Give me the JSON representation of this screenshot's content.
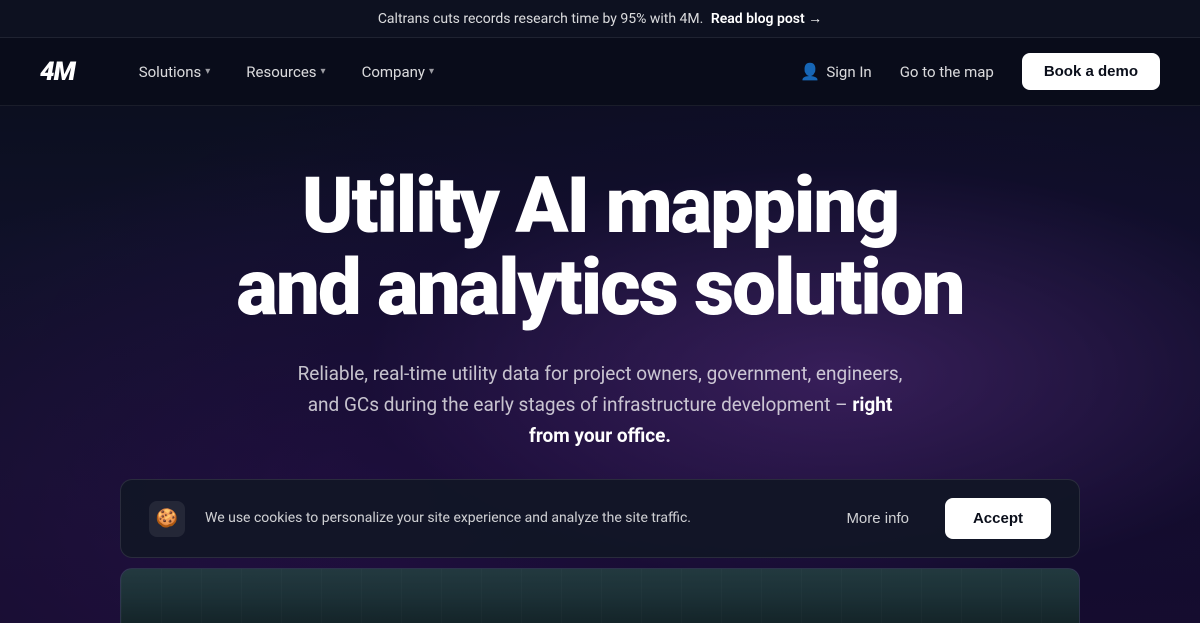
{
  "announcement": {
    "text": "Caltrans cuts records research time by 95% with 4M.",
    "link_text": "Read blog post →",
    "link_href": "#"
  },
  "nav": {
    "logo": "4M",
    "links": [
      {
        "label": "Solutions",
        "has_dropdown": true
      },
      {
        "label": "Resources",
        "has_dropdown": true
      },
      {
        "label": "Company",
        "has_dropdown": true
      }
    ],
    "sign_in_label": "Sign In",
    "go_to_map_label": "Go to the map",
    "book_demo_label": "Book a demo"
  },
  "hero": {
    "title_line1": "Utility AI mapping",
    "title_line2": "and analytics solution",
    "subtitle_plain": "Reliable, real-time utility data for project owners, government, engineers, and GCs during the early stages of infrastructure development –",
    "subtitle_bold": " right from your office."
  },
  "cookie": {
    "icon": "🍪",
    "text": "We use cookies to personalize your site experience and analyze the site traffic.",
    "more_info_label": "More info",
    "accept_label": "Accept"
  }
}
